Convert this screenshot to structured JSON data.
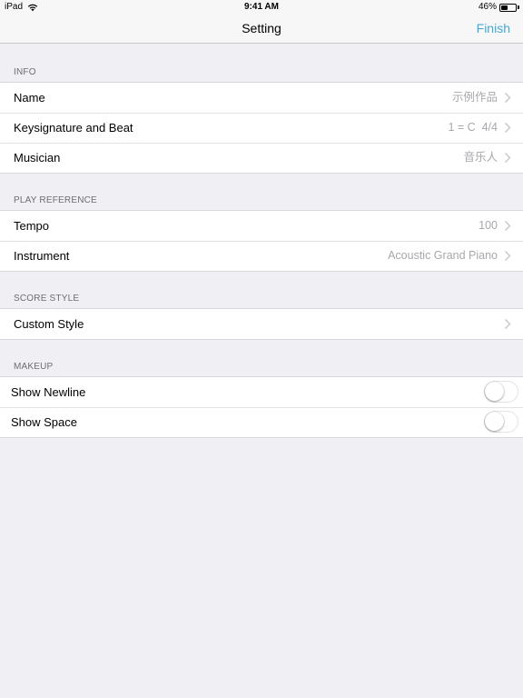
{
  "status_bar": {
    "device": "iPad",
    "time": "9:41 AM",
    "battery": "46%",
    "battery_level": 0.46
  },
  "nav": {
    "title": "Setting",
    "finish_label": "Finish"
  },
  "sections": {
    "info": {
      "header": "INFO",
      "rows": [
        {
          "label": "Name",
          "value": "示例作品"
        },
        {
          "label": "Keysignature and Beat",
          "value": "1 = C  4/4"
        },
        {
          "label": "Musician",
          "value": "音乐人"
        }
      ]
    },
    "play_reference": {
      "header": "PLAY REFERENCE",
      "rows": [
        {
          "label": "Tempo",
          "value": "100"
        },
        {
          "label": "Instrument",
          "value": "Acoustic Grand Piano"
        }
      ]
    },
    "score_style": {
      "header": "SCORE STYLE",
      "rows": [
        {
          "label": "Custom Style"
        }
      ]
    },
    "makeup": {
      "header": "MAKEUP",
      "rows": [
        {
          "label": "Show Newline",
          "on": false
        },
        {
          "label": "Show Space",
          "on": false
        }
      ]
    }
  },
  "colors": {
    "accent": "#45a9d6",
    "background": "#efeff4",
    "secondary_text": "#a8a8ad"
  }
}
